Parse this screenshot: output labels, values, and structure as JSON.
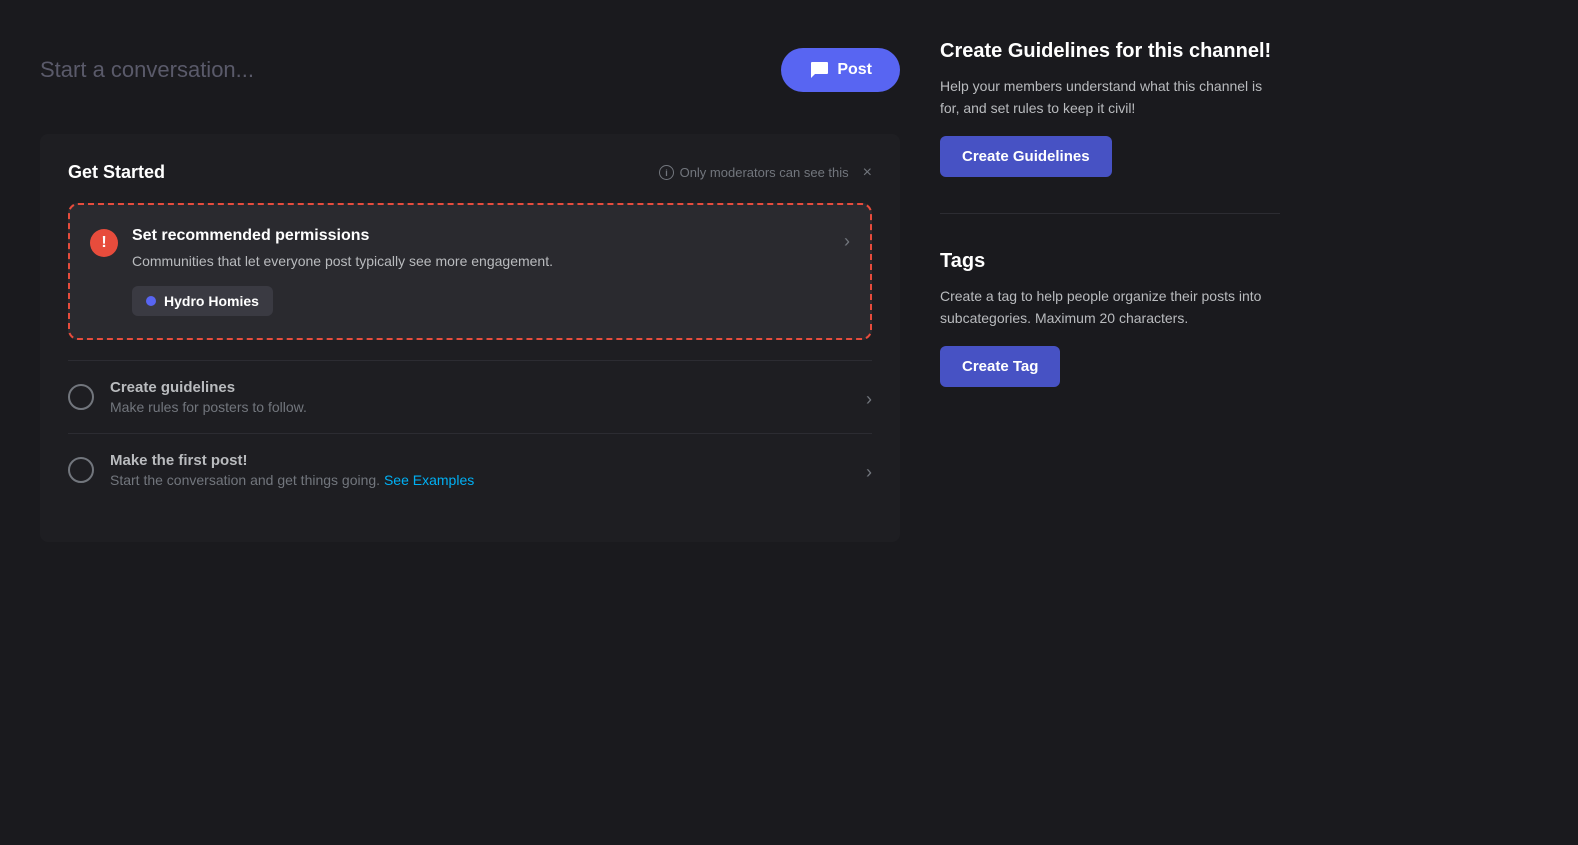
{
  "top": {
    "placeholder": "Start a conversation...",
    "post_button": "Post",
    "post_icon": "💬"
  },
  "get_started": {
    "title": "Get Started",
    "moderator_notice": "Only moderators can see this",
    "close_label": "×",
    "permissions_card": {
      "title": "Set recommended permissions",
      "description": "Communities that let everyone post typically see more engagement.",
      "community_name": "Hydro Homies"
    },
    "items": [
      {
        "title": "Create guidelines",
        "description": "Make rules for posters to follow.",
        "link": null
      },
      {
        "title": "Make the first post!",
        "description": "Start the conversation and get things going.",
        "link_text": "See Examples",
        "link_prefix": "Start the conversation and get things going. "
      }
    ]
  },
  "right": {
    "guidelines_section": {
      "title": "Create Guidelines for this channel!",
      "description": "Help your members understand what this channel is for, and set rules to keep it civil!",
      "button_label": "Create Guidelines"
    },
    "tags_section": {
      "title": "Tags",
      "description": "Create a tag to help people organize their posts into subcategories. Maximum 20 characters.",
      "button_label": "Create Tag"
    }
  }
}
